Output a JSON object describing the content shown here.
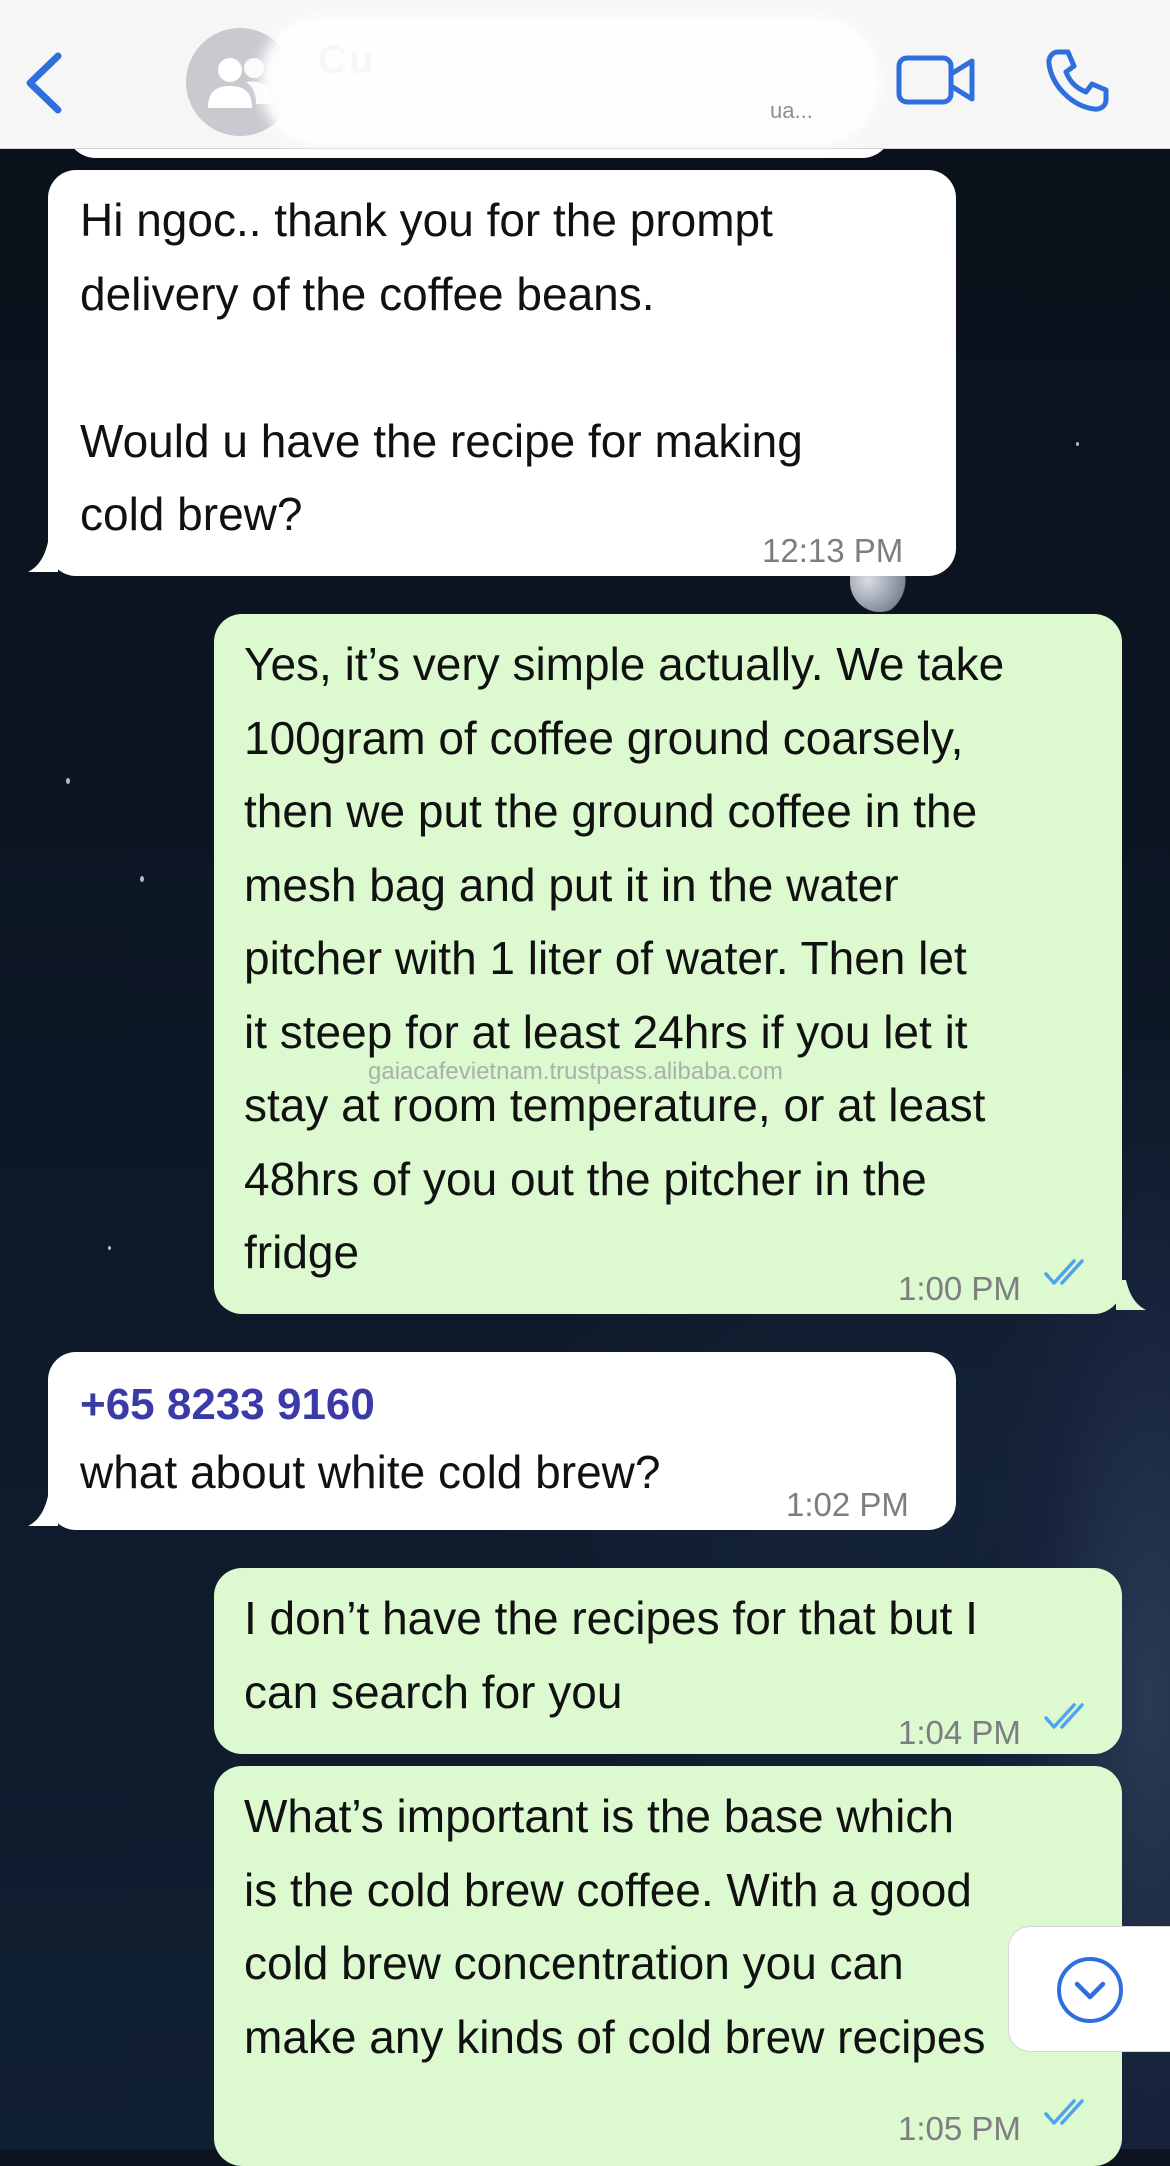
{
  "header": {
    "contact_name": "Cu",
    "contact_sub": "+6",
    "contact_sub_end": "ua..."
  },
  "messages": [
    {
      "direction": "incoming",
      "text": "Hi ngoc.. thank you for the prompt\ndelivery of the coffee beans.\n\nWould u have the recipe for making\ncold brew?",
      "time": "12:13 PM"
    },
    {
      "direction": "outgoing",
      "text": "Yes, it’s very simple actually. We take\n100gram of coffee ground coarsely,\nthen we put the ground coffee in the\nmesh bag and put it in the water\npitcher with 1 liter of water. Then let\nit steep for at least 24hrs if you let it\nstay at room temperature, or at least\n48hrs of you out the pitcher in the\nfridge",
      "time": "1:00 PM",
      "read": true
    },
    {
      "direction": "incoming",
      "sender": "+65 8233 9160",
      "text": "what about white cold brew?",
      "time": "1:02 PM"
    },
    {
      "direction": "outgoing",
      "text": "I don’t have the recipes for that but I\ncan search for you",
      "time": "1:04 PM",
      "read": true
    },
    {
      "direction": "outgoing",
      "text": "What’s important is the base which\nis the cold brew coffee. With a good\ncold brew concentration you can\nmake any kinds of cold brew recipes",
      "time": "1:05 PM",
      "read": true
    }
  ],
  "watermark": "gaiacafevietnam.trustpass.alibaba.com",
  "icons": {
    "back": "chevron-left-icon",
    "avatar": "group-avatar-icon",
    "video": "video-camera-icon",
    "call": "phone-icon",
    "read_receipt": "double-check-icon",
    "scroll_down": "chevron-down-circle-icon"
  },
  "colors": {
    "accent": "#2f6fdd",
    "outgoing_bubble": "#dcf9cf",
    "incoming_bubble": "#ffffff",
    "sender_name": "#3b3ba8",
    "read_tick": "#4fa3f0"
  }
}
